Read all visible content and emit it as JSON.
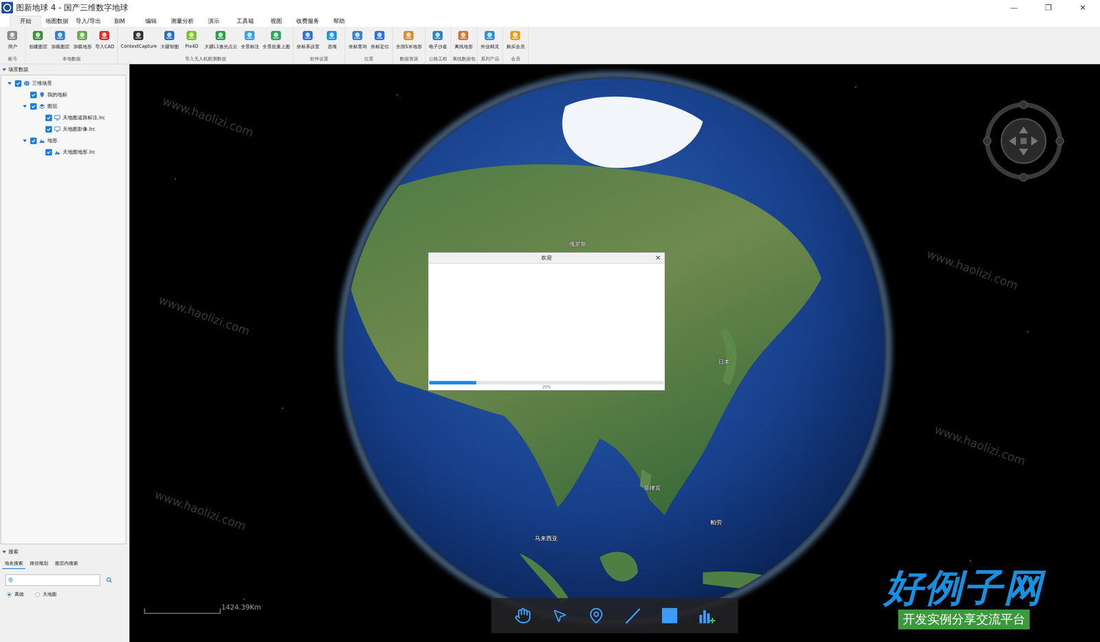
{
  "window": {
    "title": "图新地球 4 - 国产三维数字地球",
    "controls": [
      "—",
      "❐",
      "✕"
    ]
  },
  "menu": [
    {
      "label": "开始",
      "selected": true
    },
    {
      "label": "地图数据",
      "selected": false
    },
    {
      "label": "导入/导出",
      "selected": false
    },
    {
      "label": "BIM",
      "selected": false
    },
    {
      "label": "编辑",
      "selected": false
    },
    {
      "label": "测量分析",
      "selected": false
    },
    {
      "label": "演示",
      "selected": false
    },
    {
      "label": "工具箱",
      "selected": false
    },
    {
      "label": "视图",
      "selected": false
    },
    {
      "label": "收费服务",
      "selected": false
    },
    {
      "label": "帮助",
      "selected": false
    }
  ],
  "ribbon": {
    "groups": [
      {
        "label": "账号",
        "buttons": [
          {
            "label": "用户",
            "color": "#8a8a8a"
          }
        ]
      },
      {
        "label": "本地数据",
        "buttons": [
          {
            "label": "创建图层",
            "color": "#3a8f3a"
          },
          {
            "label": "加载图层",
            "color": "#2f7fd0"
          },
          {
            "label": "加载地形",
            "color": "#6aa84f"
          },
          {
            "label": "导入CAD",
            "color": "#d9322b"
          }
        ]
      },
      {
        "label": "导入无人机航测数据",
        "buttons": [
          {
            "label": "ContextCapture",
            "color": "#333333"
          },
          {
            "label": "大疆智图",
            "color": "#2b6cc4"
          },
          {
            "label": "Pix4D",
            "color": "#7bbf2a"
          },
          {
            "label": "大疆L1激光点云",
            "color": "#2e9e4f"
          },
          {
            "label": "全景标注",
            "color": "#3aa0e0"
          },
          {
            "label": "全景批量上图",
            "color": "#2fa35a"
          }
        ]
      },
      {
        "label": "软件设置",
        "buttons": [
          {
            "label": "坐标系设置",
            "color": "#2f6fd0"
          },
          {
            "label": "选项",
            "color": "#1f8fe0"
          }
        ]
      },
      {
        "label": "位置",
        "buttons": [
          {
            "label": "坐标查询",
            "color": "#3a7fd0"
          },
          {
            "label": "坐标定位",
            "color": "#2e6fe0"
          }
        ]
      },
      {
        "label": "数据资源",
        "buttons": [
          {
            "label": "全国5米地形",
            "color": "#d98a2b"
          }
        ]
      },
      {
        "label": "公路工程",
        "buttons": [
          {
            "label": "电子沙盘",
            "color": "#2f7fbf"
          }
        ]
      },
      {
        "label": "离线数据包",
        "buttons": [
          {
            "label": "离线地形",
            "color": "#c9783a"
          }
        ]
      },
      {
        "label": "系列产品",
        "buttons": [
          {
            "label": "外业精灵",
            "color": "#2f8fd0"
          }
        ]
      },
      {
        "label": "会员",
        "buttons": [
          {
            "label": "购买会员",
            "color": "#e0a020"
          }
        ]
      }
    ]
  },
  "scene_panel": {
    "title": "场景数据",
    "items": [
      {
        "label": "三维场景",
        "depth": 0,
        "kind": "scene",
        "checked": true,
        "expanded": true
      },
      {
        "label": "我的地标",
        "depth": 1,
        "kind": "placemark",
        "checked": true
      },
      {
        "label": "图层",
        "depth": 1,
        "kind": "layers",
        "checked": true,
        "expanded": true
      },
      {
        "label": "天地图道路标注.lrc",
        "depth": 2,
        "kind": "layer",
        "checked": true
      },
      {
        "label": "天地图影像.lrc",
        "depth": 2,
        "kind": "layer",
        "checked": true
      },
      {
        "label": "地形",
        "depth": 1,
        "kind": "terrain",
        "checked": true,
        "expanded": true
      },
      {
        "label": "天地图地形.lrc",
        "depth": 2,
        "kind": "terrain",
        "checked": true
      }
    ]
  },
  "search_panel": {
    "title": "搜索",
    "tabs": [
      {
        "label": "地名搜索",
        "selected": true
      },
      {
        "label": "路径规划",
        "selected": false
      },
      {
        "label": "图层内搜索",
        "selected": false
      }
    ],
    "providers": [
      {
        "label": "高德",
        "selected": true
      },
      {
        "label": "天地图",
        "selected": false
      }
    ]
  },
  "dialog": {
    "title": "欢迎",
    "close": "×",
    "progress": {
      "level": 0.2,
      "reading": "20%"
    }
  },
  "scale_bar": {
    "reading": "1424.39Km"
  },
  "map_labels": [
    "俄罗斯",
    "日本",
    "菲律宾",
    "帕劳",
    "马来西亚"
  ],
  "watermark": {
    "site": "www.haolizi.com",
    "logo": "好例子网",
    "slogan": "开发实例分享交流平台"
  }
}
